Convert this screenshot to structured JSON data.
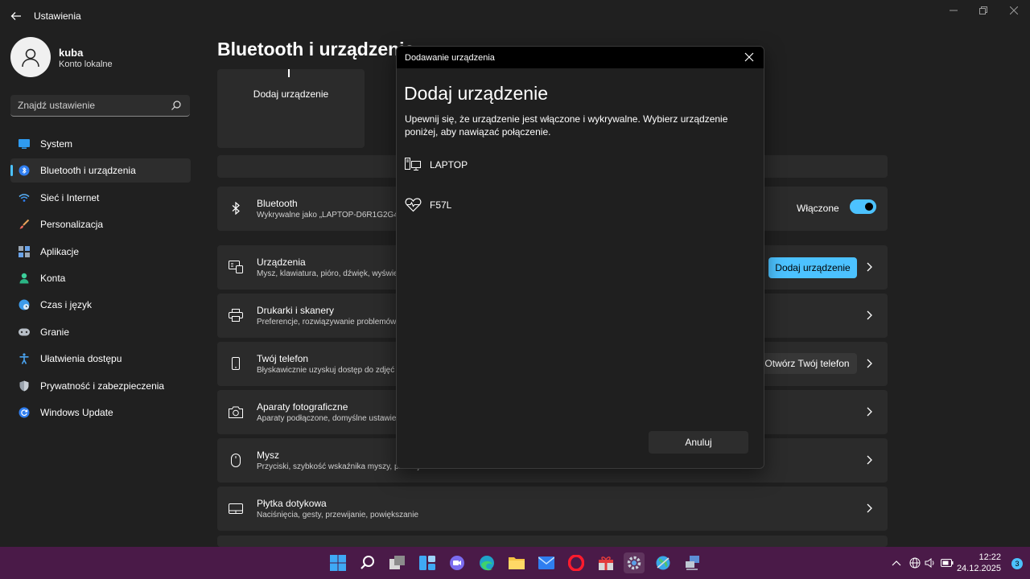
{
  "window": {
    "app_title": "Ustawienia",
    "back_icon": "arrow-left-icon",
    "controls": [
      "minimize-icon",
      "restore-icon",
      "close-icon"
    ]
  },
  "profile": {
    "name": "kuba",
    "account_type": "Konto lokalne"
  },
  "search": {
    "placeholder": "Znajdź ustawienie"
  },
  "sidebar": {
    "items": [
      {
        "label": "System",
        "icon": "monitor-icon"
      },
      {
        "label": "Bluetooth i urządzenia",
        "icon": "bluetooth-icon",
        "active": true
      },
      {
        "label": "Sieć i Internet",
        "icon": "wifi-icon"
      },
      {
        "label": "Personalizacja",
        "icon": "brush-icon"
      },
      {
        "label": "Aplikacje",
        "icon": "apps-icon"
      },
      {
        "label": "Konta",
        "icon": "person-icon"
      },
      {
        "label": "Czas i język",
        "icon": "globe-clock-icon"
      },
      {
        "label": "Granie",
        "icon": "gamepad-icon"
      },
      {
        "label": "Ułatwienia dostępu",
        "icon": "accessibility-icon"
      },
      {
        "label": "Prywatność i zabezpieczenia",
        "icon": "shield-icon"
      },
      {
        "label": "Windows Update",
        "icon": "update-icon"
      }
    ]
  },
  "main": {
    "title": "Bluetooth i urządzenia",
    "add_tile_label": "Dodaj urządzenie",
    "bluetooth": {
      "title": "Bluetooth",
      "subtitle": "Wykrywalne jako „LAPTOP-D6R1G2G4”",
      "state_label": "Włączone",
      "enabled": true
    },
    "cards": [
      {
        "title": "Urządzenia",
        "subtitle": "Mysz, klawiatura, pióro, dźwięk, wyświetlacze",
        "icon": "devices-icon",
        "action": "Dodaj urządzenie"
      },
      {
        "title": "Drukarki i skanery",
        "subtitle": "Preferencje, rozwiązywanie problemów",
        "icon": "printer-icon"
      },
      {
        "title": "Twój telefon",
        "subtitle": "Błyskawicznie uzyskuj dostęp do zdjęć",
        "icon": "phone-icon",
        "action": "Otwórz Twój telefon"
      },
      {
        "title": "Aparaty fotograficzne",
        "subtitle": "Aparaty podłączone, domyślne ustawienia",
        "icon": "camera-icon"
      },
      {
        "title": "Mysz",
        "subtitle": "Przyciski, szybkość wskaźnika myszy, przewijanie",
        "icon": "mouse-icon"
      },
      {
        "title": "Płytka dotykowa",
        "subtitle": "Naciśnięcia, gesty, przewijanie, powiększanie",
        "icon": "touchpad-icon"
      }
    ]
  },
  "dialog": {
    "window_title": "Dodawanie urządzenia",
    "heading": "Dodaj urządzenie",
    "description": "Upewnij się, że urządzenie jest włączone i wykrywalne. Wybierz urządzenie poniżej, aby nawiązać połączenie.",
    "devices": [
      {
        "name": "LAPTOP",
        "icon": "computer-icon"
      },
      {
        "name": "F57L",
        "icon": "heart-rate-icon"
      }
    ],
    "cancel_label": "Anuluj"
  },
  "taskbar": {
    "apps": [
      "start-icon",
      "search-icon",
      "task-view-icon",
      "widgets-icon",
      "chat-icon",
      "edge-icon",
      "file-explorer-icon",
      "mail-icon",
      "opera-icon",
      "gift-app-icon",
      "settings-icon",
      "globe-app-icon",
      "network-app-icon"
    ],
    "time": "12:22",
    "date": "24.12.2025",
    "notifications": "3",
    "colors": {
      "accent": "#4cc2ff",
      "taskbar_bg": "#4a1a48"
    }
  }
}
